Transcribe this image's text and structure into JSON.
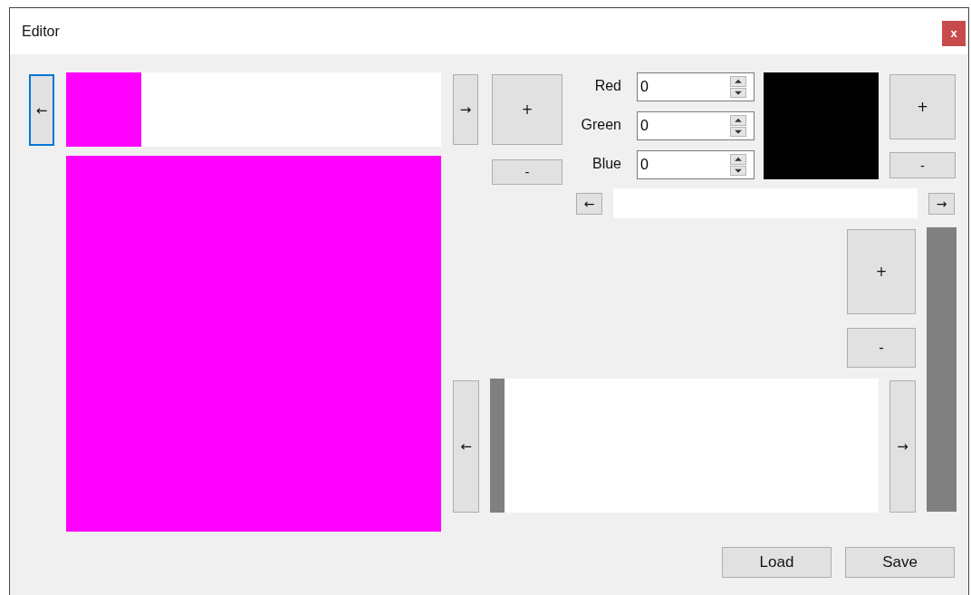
{
  "window": {
    "title": "Editor",
    "close": "x"
  },
  "frame_nav": {
    "prev": "←",
    "prev_focused": true,
    "next": "→"
  },
  "frames": [
    {
      "color": "#ff00ff"
    }
  ],
  "canvas": {
    "color": "#ff00ff"
  },
  "frame_buttons": {
    "add": "+",
    "remove": "-"
  },
  "color_fields": [
    {
      "label": "Red",
      "value": "0"
    },
    {
      "label": "Green",
      "value": "0"
    },
    {
      "label": "Blue",
      "value": "0"
    }
  ],
  "color_preview": {
    "color": "#000000"
  },
  "palette_buttons": {
    "add": "+",
    "remove": "-"
  },
  "palette_nav": {
    "prev": "←",
    "next": "→"
  },
  "layer_buttons": {
    "add": "+",
    "remove": "-"
  },
  "strip_nav": {
    "prev": "←",
    "next": "→"
  },
  "footer": {
    "load": "Load",
    "save": "Save"
  }
}
